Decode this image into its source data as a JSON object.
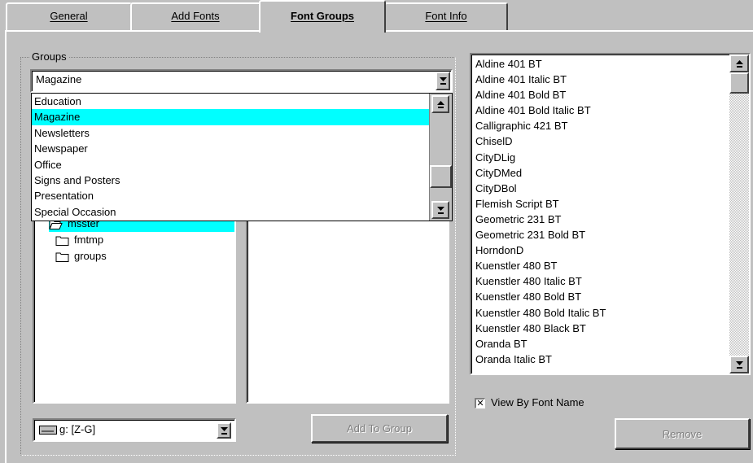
{
  "tabs": [
    {
      "label": "General"
    },
    {
      "label": "Add Fonts"
    },
    {
      "label": "Font Groups"
    },
    {
      "label": "Font Info"
    }
  ],
  "active_tab": "Font Groups",
  "groups": {
    "label": "Groups",
    "selected": "Magazine",
    "options": [
      "Education",
      "Magazine",
      "Newsletters",
      "Newspaper",
      "Office",
      "Signs and Posters",
      "Presentation",
      "Special Occasion"
    ],
    "highlighted": "Magazine"
  },
  "tree": {
    "items": [
      {
        "label": "msster",
        "icon": "open-folder-icon",
        "selected": true
      },
      {
        "label": "fmtmp",
        "icon": "folder-icon",
        "selected": false
      },
      {
        "label": "groups",
        "icon": "folder-icon",
        "selected": false
      }
    ]
  },
  "drive_combo": {
    "value": "g: [Z-G]",
    "icon": "drive-icon"
  },
  "add_to_group_button": {
    "label": "Add To Group",
    "enabled": false
  },
  "fonts_list": {
    "items": [
      "Aldine 401 BT",
      "Aldine 401 Italic BT",
      "Aldine 401 Bold BT",
      "Aldine 401 Bold Italic BT",
      "Calligraphic 421 BT",
      "ChiselD",
      "CityDLig",
      "CityDMed",
      "CityDBol",
      "Flemish Script BT",
      "Geometric 231 BT",
      "Geometric 231 Bold BT",
      "HorndonD",
      "Kuenstler 480 BT",
      "Kuenstler 480 Italic BT",
      "Kuenstler 480 Bold BT",
      "Kuenstler 480 Bold Italic BT",
      "Kuenstler 480 Black BT",
      "Oranda BT",
      "Oranda Italic BT"
    ]
  },
  "view_by_font_name": {
    "label": "View By Font Name",
    "checked": true
  },
  "remove_button": {
    "label": "Remove",
    "enabled": false
  },
  "colors": {
    "face": "#c0c0c0",
    "highlight": "#00ffff",
    "window": "#ffffff"
  }
}
